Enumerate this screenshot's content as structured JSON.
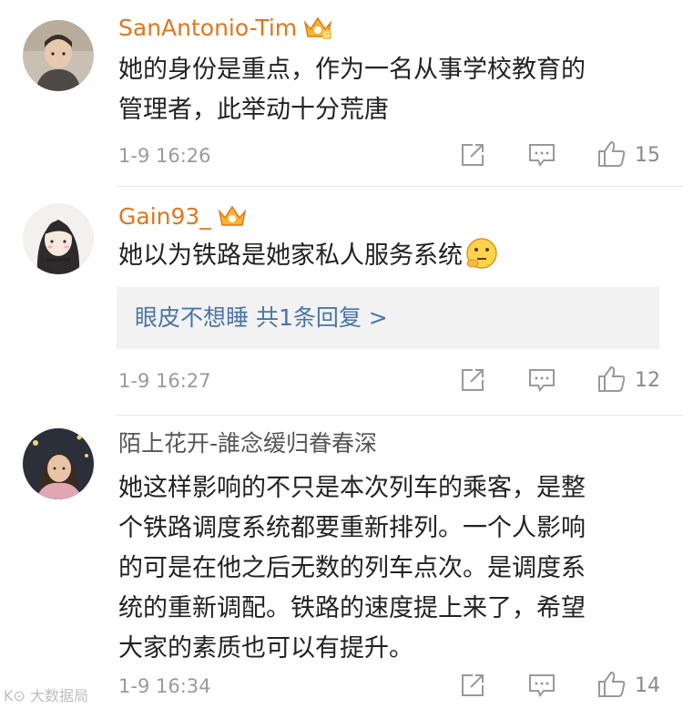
{
  "comments": [
    {
      "username": "SanAntonio-Tim",
      "vip": true,
      "lines": [
        "她的身份是重点，作为一名从事学校教育的",
        "管理者，此举动十分荒唐"
      ],
      "time": "1-9 16:26",
      "likes": "15"
    },
    {
      "username": "Gain93_",
      "vip": true,
      "lines": [
        "她以为铁路是她家私人服务系统"
      ],
      "emoji": "thinking-face",
      "reply": "眼皮不想睡  共1条回复 >",
      "time": "1-9 16:27",
      "likes": "12"
    },
    {
      "username": "陌上花开-誰念缓归眷春深",
      "vip": false,
      "lines": [
        "她这样影响的不只是本次列车的乘客，是整",
        "个铁路调度系统都要重新排列。一个人影响",
        "的可是在他之后无数的列车点次。是调度系",
        "统的重新调配。铁路的速度提上来了，希望",
        "大家的素质也可以有提升。"
      ],
      "time": "1-9 16:34",
      "likes": "14"
    }
  ],
  "watermark": "大数据局",
  "icons": [
    "share-icon",
    "comment-icon",
    "like-icon",
    "vip-crown-icon"
  ],
  "colors": {
    "vip_name": "#e0771d",
    "reply_link": "#4a75a5",
    "meta": "#9a9a9a"
  }
}
